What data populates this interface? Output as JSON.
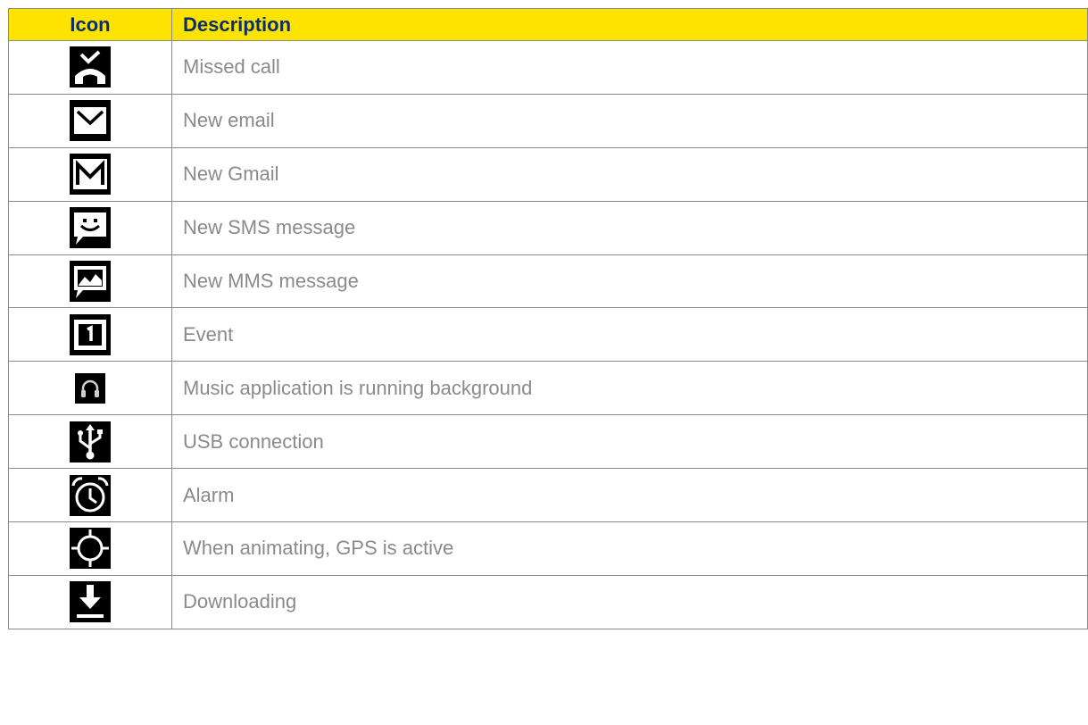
{
  "header": {
    "icon": "Icon",
    "description": "Description"
  },
  "colors": {
    "header_bg": "#ffe300",
    "header_text": "#0a2f6b",
    "desc_text": "#8a8a8a",
    "border": "#8a8a8a"
  },
  "rows": [
    {
      "icon": "missed-call-icon",
      "label": "Missed call"
    },
    {
      "icon": "email-icon",
      "label": "New email"
    },
    {
      "icon": "gmail-icon",
      "label": "New Gmail"
    },
    {
      "icon": "sms-icon",
      "label": "New SMS message"
    },
    {
      "icon": "mms-icon",
      "label": "New MMS message"
    },
    {
      "icon": "calendar-event-icon",
      "label": "Event"
    },
    {
      "icon": "headphones-icon",
      "label": "Music application is running background"
    },
    {
      "icon": "usb-icon",
      "label": "USB connection"
    },
    {
      "icon": "alarm-icon",
      "label": "Alarm"
    },
    {
      "icon": "gps-icon",
      "label": "When animating, GPS is active"
    },
    {
      "icon": "download-icon",
      "label": "Downloading"
    }
  ]
}
